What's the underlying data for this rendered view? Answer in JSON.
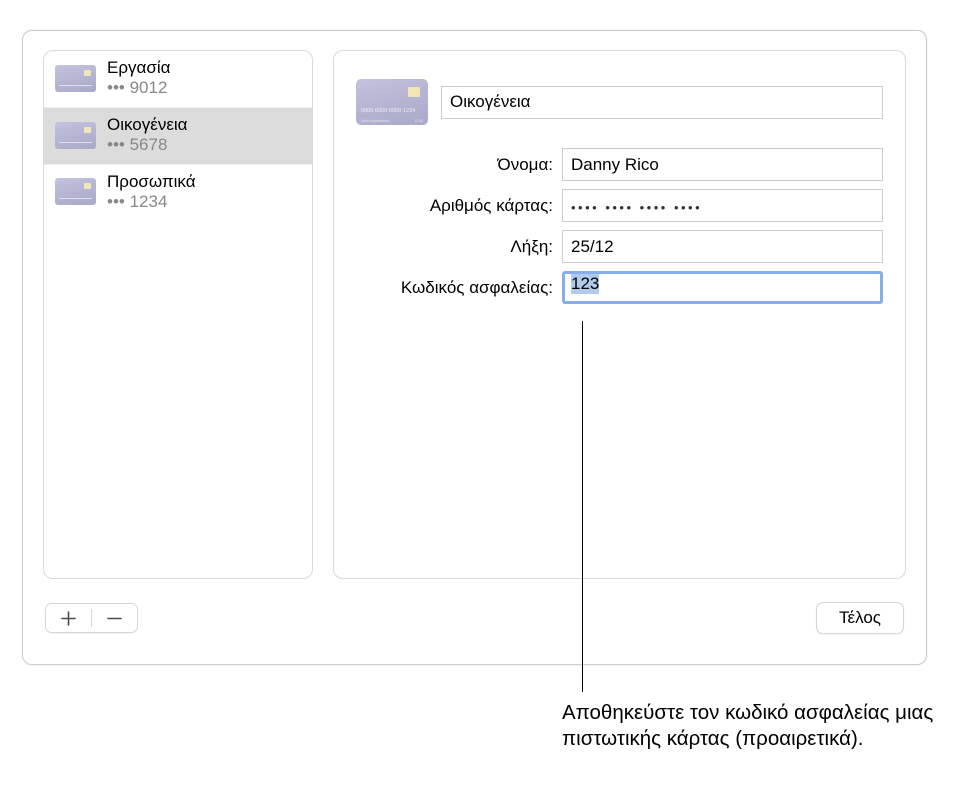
{
  "sidebar": {
    "items": [
      {
        "title": "Εργασία",
        "mask": "••• 9012",
        "selected": false
      },
      {
        "title": "Οικογένεια",
        "mask": "••• 5678",
        "selected": true
      },
      {
        "title": "Προσωπικά",
        "mask": "••• 1234",
        "selected": false
      }
    ]
  },
  "detail": {
    "card_name": "Οικογένεια",
    "fields": {
      "name_label": "Όνομα:",
      "name_value": "Danny Rico",
      "number_label": "Αριθμός κάρτας:",
      "number_value": "•••• •••• •••• ••••",
      "expiry_label": "Λήξη:",
      "expiry_value": "25/12",
      "security_label": "Κωδικός ασφαλείας:",
      "security_value": "123"
    }
  },
  "footer": {
    "done_label": "Τέλος"
  },
  "callout": {
    "text": "Αποθηκεύστε τον κωδικό ασφαλείας μιας πιστωτικής κάρτας (προαιρετικά)."
  }
}
